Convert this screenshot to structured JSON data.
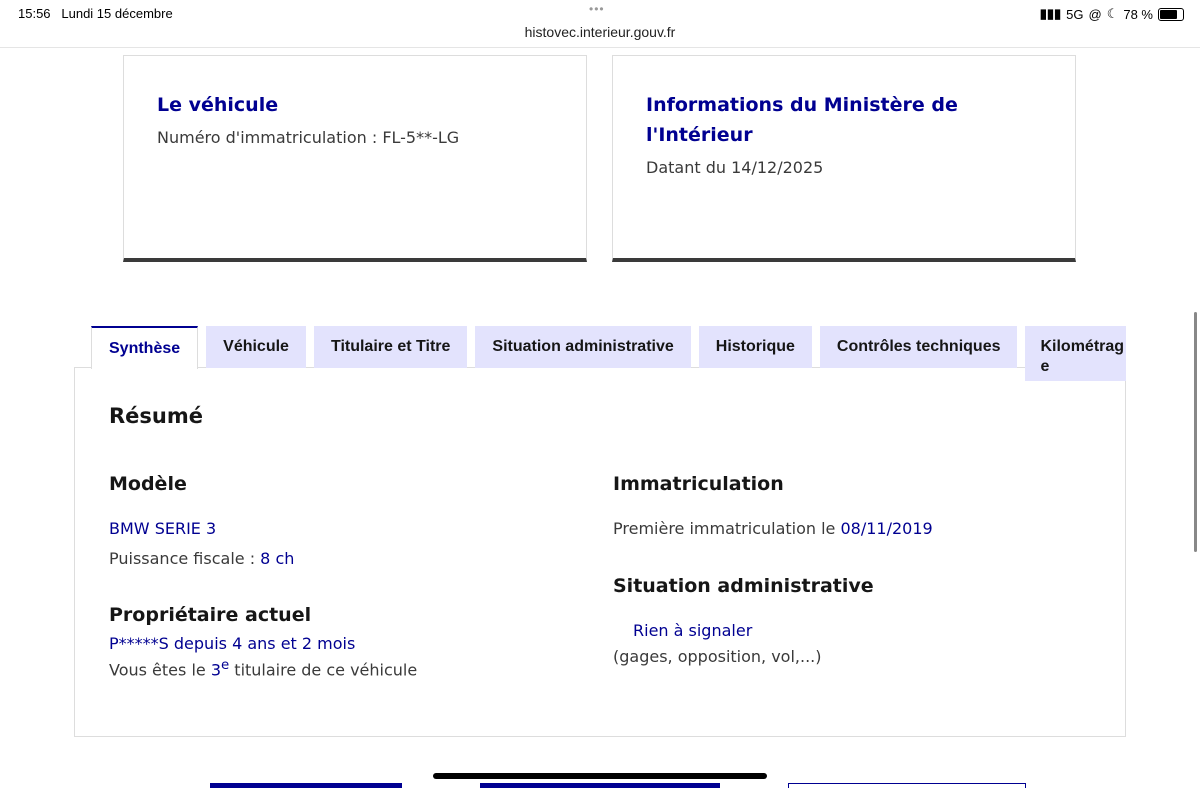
{
  "status_bar": {
    "time": "15:56",
    "date": "Lundi 15 décembre",
    "network": "5G",
    "battery": "78 %",
    "battery_level": 0.78
  },
  "browser": {
    "url": "histovec.interieur.gouv.fr"
  },
  "cards": [
    {
      "title": "Le véhicule",
      "text": "Numéro d'immatriculation : FL-5**-LG"
    },
    {
      "title": "Informations du Ministère de l'Intérieur",
      "text": "Datant du 14/12/2025"
    }
  ],
  "tabs": [
    "Synthèse",
    "Véhicule",
    "Titulaire et Titre",
    "Situation administrative",
    "Historique",
    "Contrôles techniques",
    "Kilométrage"
  ],
  "summary": {
    "title": "Résumé",
    "model": {
      "heading": "Modèle",
      "name": "BMW SERIE 3",
      "power_label": "Puissance fiscale : ",
      "power_value": "8 ch"
    },
    "owner": {
      "heading": "Propriétaire actuel",
      "name": "P*****S",
      "since_label": " depuis ",
      "since_value": "4 ans et 2 mois",
      "rank_prefix": "Vous êtes le ",
      "rank": "3",
      "rank_sup": "e",
      "rank_suffix": " titulaire de ce véhicule"
    },
    "registration": {
      "heading": "Immatriculation",
      "label": "Première immatriculation le ",
      "date": "08/11/2019"
    },
    "admin": {
      "heading": "Situation administrative",
      "status": "Rien à signaler",
      "detail": "(gages, opposition, vol,...)"
    }
  }
}
